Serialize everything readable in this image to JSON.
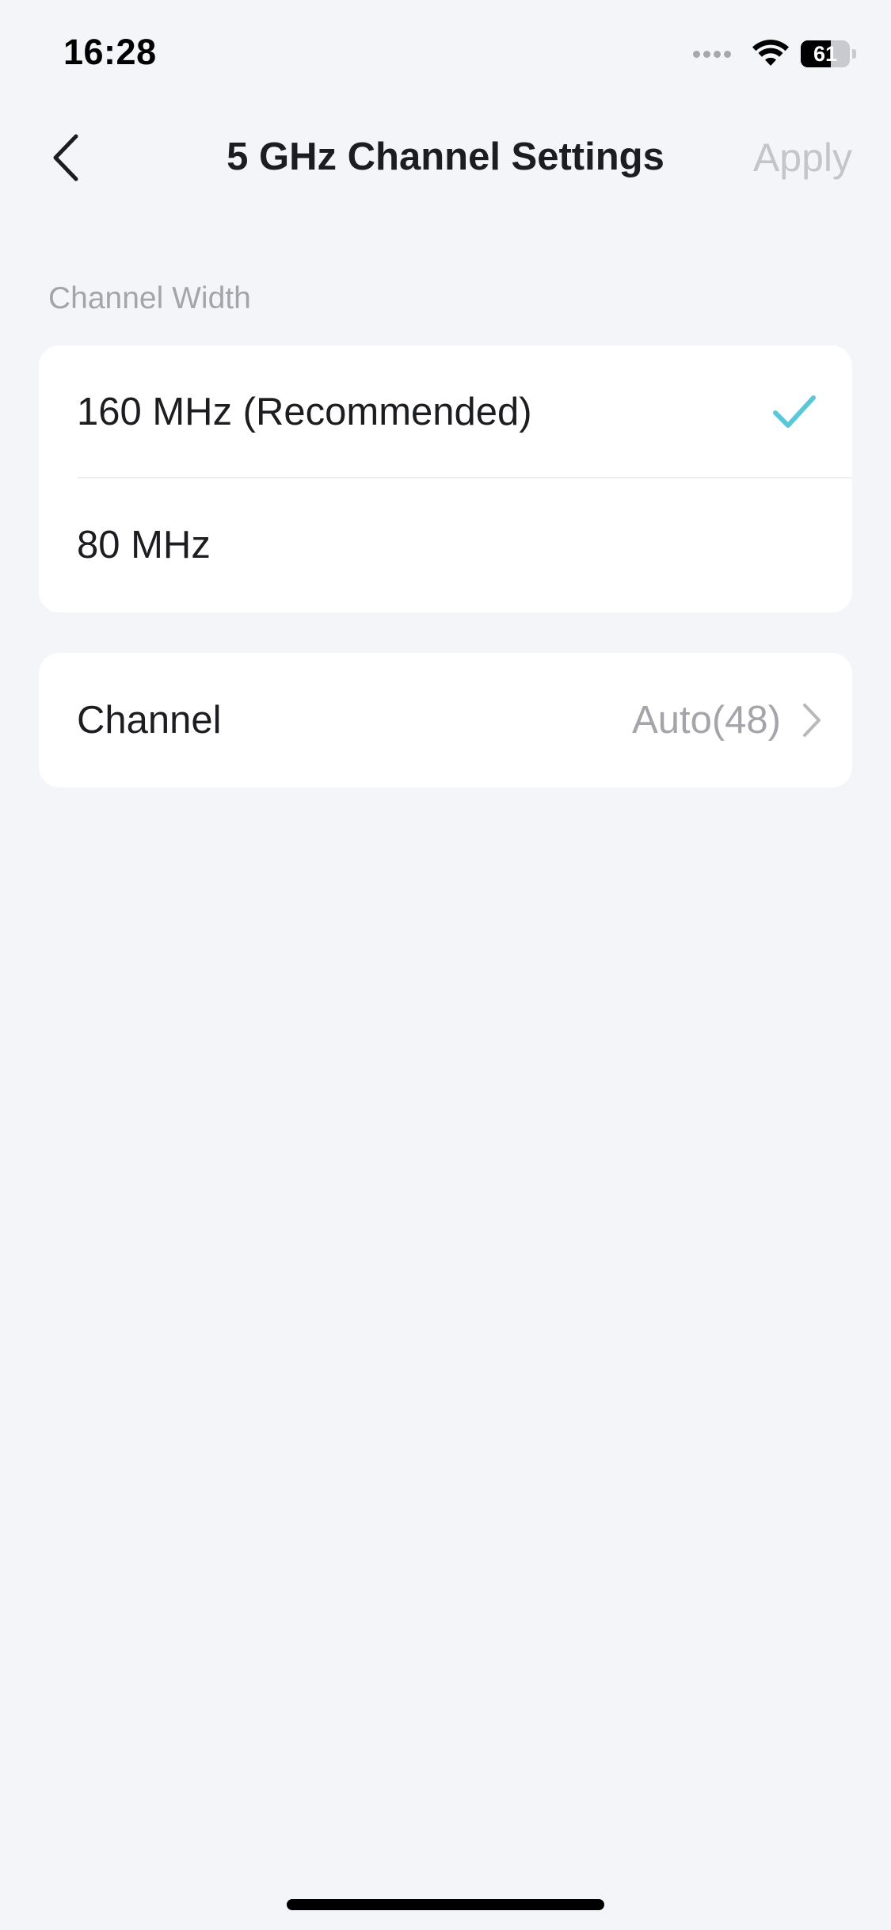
{
  "status_bar": {
    "time": "16:28",
    "battery_level": "61",
    "battery_fraction": 0.61
  },
  "nav": {
    "title": "5 GHz Channel Settings",
    "apply_label": "Apply",
    "back_icon": "chevron-left-icon"
  },
  "channel_width": {
    "section_label": "Channel Width",
    "options": [
      {
        "label": "160 MHz (Recommended)",
        "selected": true
      },
      {
        "label": "80 MHz",
        "selected": false
      }
    ],
    "check_icon": "checkmark-icon"
  },
  "channel": {
    "label": "Channel",
    "value": "Auto(48)",
    "chevron_icon": "chevron-right-icon"
  },
  "colors": {
    "background": "#f4f5f9",
    "card": "#ffffff",
    "accent": "#5bc8d9",
    "muted_text": "#a3a5ab",
    "disabled_action": "#c3c5cb",
    "primary_text": "#1c1d21"
  }
}
